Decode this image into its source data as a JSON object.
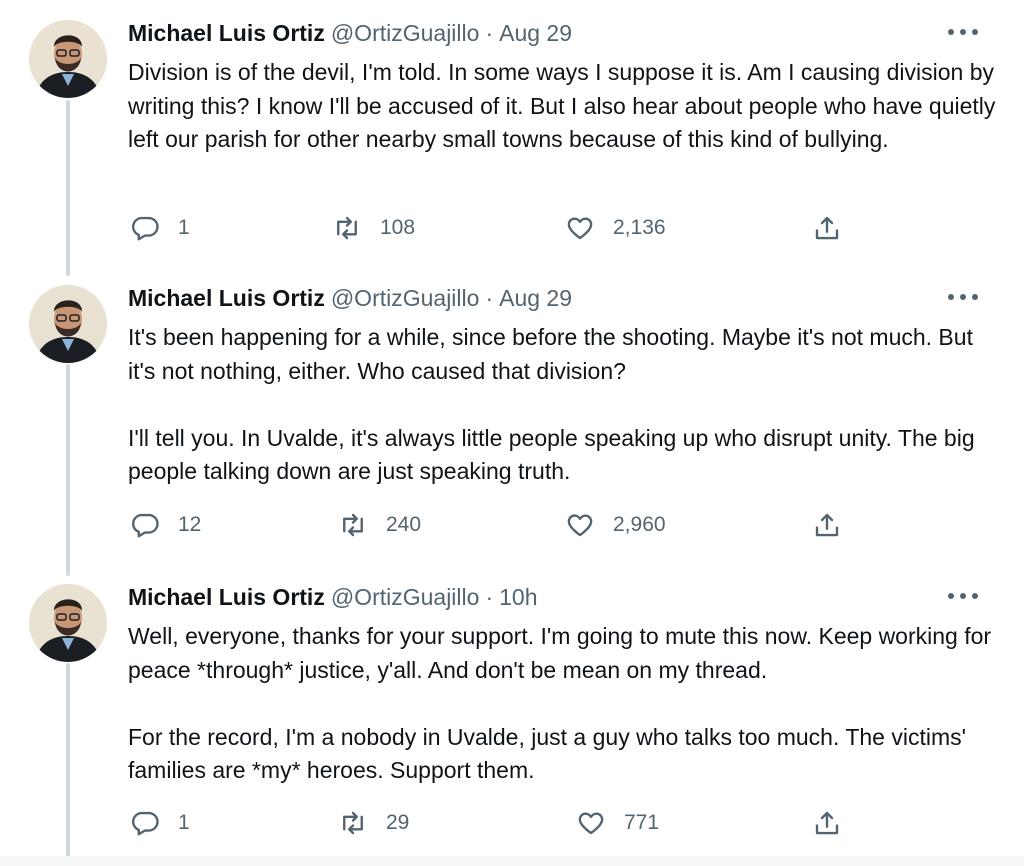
{
  "tweets": [
    {
      "name": "Michael Luis Ortiz",
      "handle": "@OrtizGuajillo",
      "sep": "·",
      "time": "Aug 29",
      "paragraphs": [
        "Division is of the devil, I'm told. In some ways I suppose it is. Am I causing division by writing this? I know I'll be accused of it. But I also hear about people who have quietly left our parish for other nearby small towns because of this kind of bullying."
      ],
      "replies": "1",
      "retweets": "108",
      "likes": "2,136"
    },
    {
      "name": "Michael Luis Ortiz",
      "handle": "@OrtizGuajillo",
      "sep": "·",
      "time": "Aug 29",
      "paragraphs": [
        "It's been happening for a while, since before the shooting. Maybe it's not much. But it's not nothing, either. Who caused that division?",
        "I'll tell you. In Uvalde, it's always little people speaking up who disrupt unity. The big people talking down are just speaking truth."
      ],
      "replies": "12",
      "retweets": "240",
      "likes": "2,960"
    },
    {
      "name": "Michael Luis Ortiz",
      "handle": "@OrtizGuajillo",
      "sep": "·",
      "time": "10h",
      "paragraphs": [
        "Well, everyone, thanks for your support. I'm going to mute this now. Keep working for peace *through* justice, y'all. And don't be mean on my thread.",
        "For the record, I'm a nobody in Uvalde, just a guy who talks too much. The victims' families are *my* heroes. Support them."
      ],
      "replies": "1",
      "retweets": "29",
      "likes": "771"
    }
  ],
  "colors": {
    "text": "#0f1419",
    "muted": "#536471",
    "thread_line": "#cfd9de"
  },
  "icons": [
    "more-icon",
    "reply-icon",
    "retweet-icon",
    "like-icon",
    "share-icon"
  ]
}
